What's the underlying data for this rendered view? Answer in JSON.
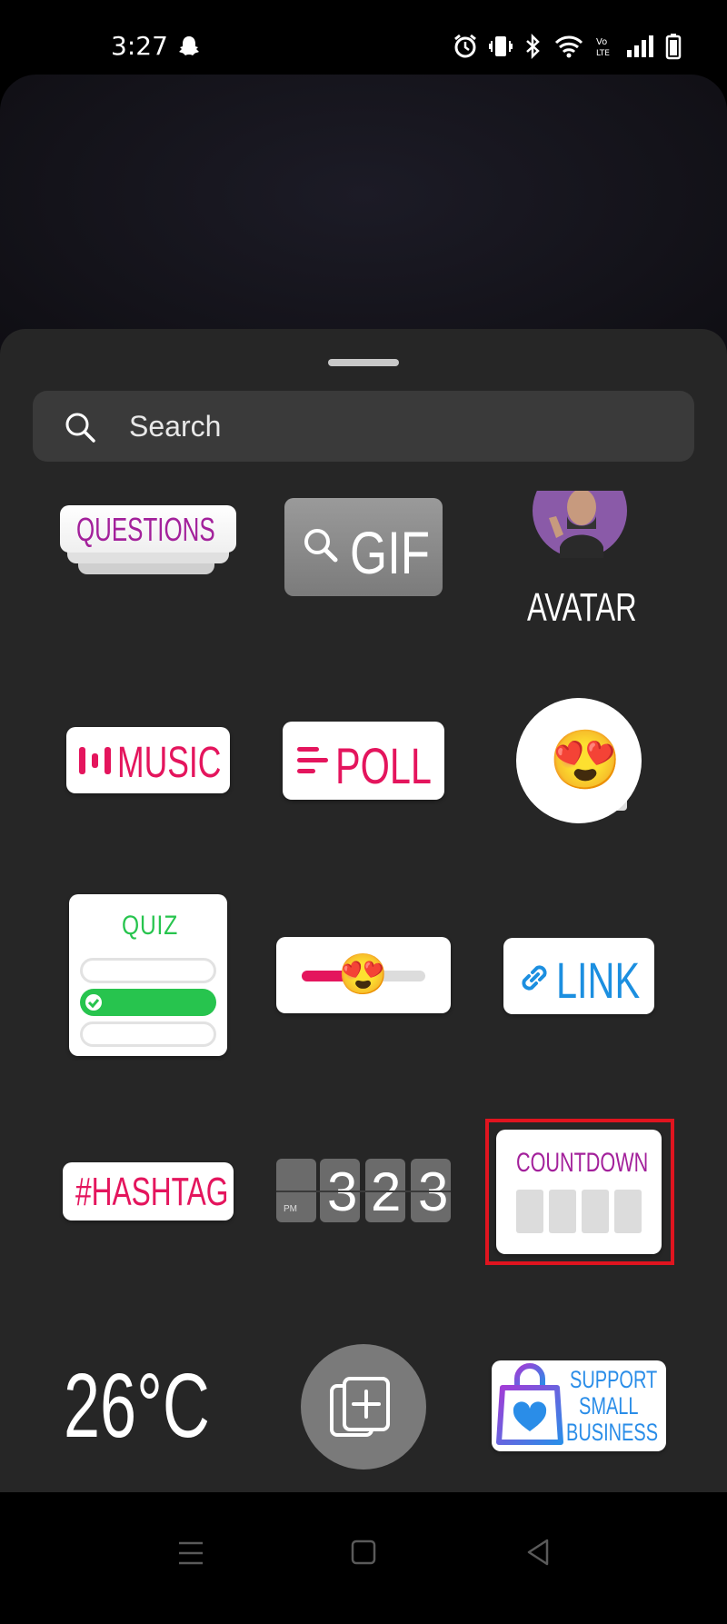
{
  "status_bar": {
    "time": "3:27"
  },
  "search": {
    "placeholder": "Search",
    "value": ""
  },
  "stickers": {
    "questions": "QUESTIONS",
    "gif": "GIF",
    "avatar": "AVATAR",
    "music": "MUSIC",
    "poll": "POLL",
    "emoji_emoji": "😍",
    "quiz": "QUIZ",
    "slider_emoji": "😍",
    "link": "LINK",
    "hashtag": "#HASHTAG",
    "time_pm": "PM",
    "time_digits": [
      "3",
      "2",
      "3"
    ],
    "countdown": "COUNTDOWN",
    "weather": "26°C",
    "support_line1": "SUPPORT",
    "support_line2": "SMALL",
    "support_line3": "BUSINESS"
  },
  "colors": {
    "magenta": "#c2178d",
    "pink": "#e4155d",
    "quiz_green": "#27c44e",
    "link_blue": "#1c8fe0",
    "highlight_red": "#e0141f"
  },
  "highlight": {
    "target": "countdown-sticker"
  }
}
